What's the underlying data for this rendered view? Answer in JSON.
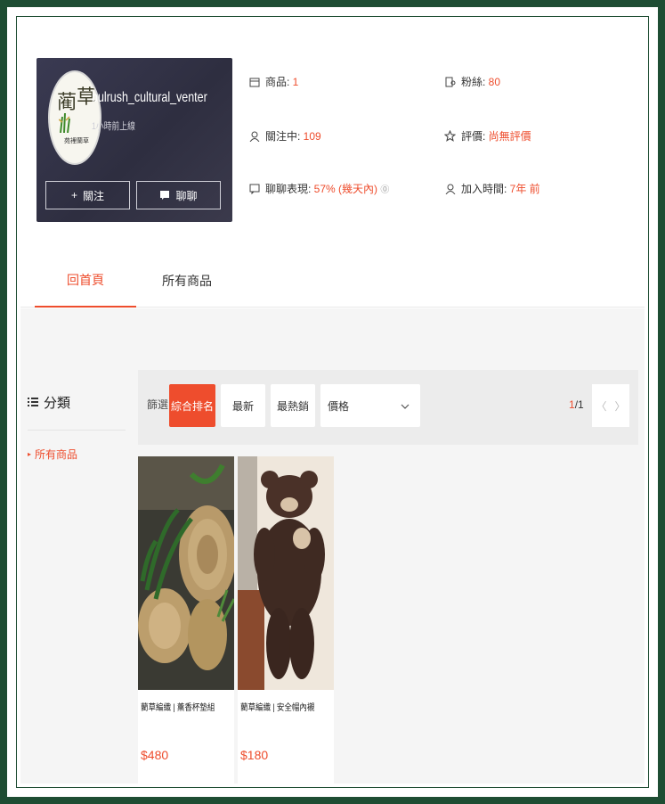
{
  "shop": {
    "name": "bulrush_cultural_venter",
    "active": "1小時前上線",
    "logo_text_1": "蔺",
    "logo_text_2": "草",
    "logo_sub": "苑裡蘭草",
    "follow_label": "關注",
    "chat_label": "聊聊"
  },
  "stats": {
    "products_label": "商品: ",
    "products_value": "1",
    "followers_label": "粉絲: ",
    "followers_value": "80",
    "following_label": "關注中: ",
    "following_value": "109",
    "rating_label": "評價: ",
    "rating_value": "尚無評價",
    "chat_perf_label": "聊聊表現: ",
    "chat_perf_value": "57% (幾天內)",
    "chat_perf_tip": "⓪",
    "joined_label": "加入時間: ",
    "joined_value": "7年 前"
  },
  "tabs": {
    "home": "回首頁",
    "all_products": "所有商品"
  },
  "sidebar": {
    "title": "分類",
    "items": [
      "所有商品"
    ]
  },
  "sortbar": {
    "label": "篩選",
    "relevance": "綜合排名",
    "latest": "最新",
    "top_sales": "最熱銷",
    "price": "價格",
    "page_current": "1",
    "page_total": "/1"
  },
  "products": [
    {
      "name": "藺草編織 | 薰香杯墊組",
      "price": "$480"
    },
    {
      "name": "藺草編織 | 安全帽內襯",
      "price": "$180"
    }
  ],
  "colors": {
    "accent": "#ee4d2d",
    "frame": "#1e4d33",
    "card_bg": "#2e2e40"
  }
}
